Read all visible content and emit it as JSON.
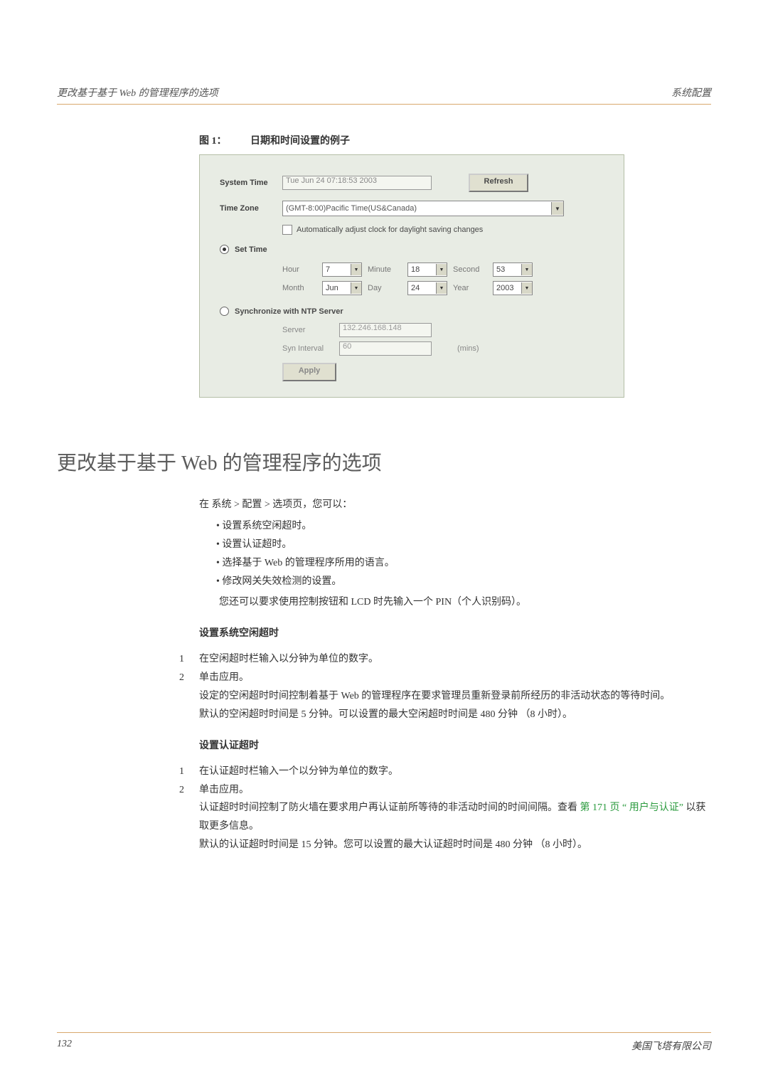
{
  "header": {
    "left": "更改基于基于 Web 的管理程序的选项",
    "right": "系统配置"
  },
  "figure": {
    "label": "图 1：",
    "caption": "日期和时间设置的例子"
  },
  "panel": {
    "systemTimeLabel": "System Time",
    "systemTimeValue": "Tue Jun 24 07:18:53 2003",
    "refresh": "Refresh",
    "timeZoneLabel": "Time Zone",
    "timeZoneValue": "(GMT-8:00)Pacific Time(US&Canada)",
    "dstLabel": "Automatically adjust clock for daylight saving changes",
    "setTimeLabel": "Set Time",
    "fields": {
      "hour": {
        "label": "Hour",
        "value": "7"
      },
      "minute": {
        "label": "Minute",
        "value": "18"
      },
      "second": {
        "label": "Second",
        "value": "53"
      },
      "month": {
        "label": "Month",
        "value": "Jun"
      },
      "day": {
        "label": "Day",
        "value": "24"
      },
      "year": {
        "label": "Year",
        "value": "2003"
      }
    },
    "ntpLabel": "Synchronize with NTP Server",
    "ntp": {
      "serverLabel": "Server",
      "serverValue": "132.246.168.148",
      "intervalLabel": "Syn Interval",
      "intervalValue": "60",
      "intervalUnit": "(mins)"
    },
    "apply": "Apply"
  },
  "section": {
    "title": "更改基于基于 Web 的管理程序的选项",
    "intro": "在 系统 > 配置 > 选项页，您可以：",
    "bullets": [
      "设置系统空闲超时。",
      "设置认证超时。",
      "选择基于 Web 的管理程序所用的语言。",
      "修改网关失效检测的设置。"
    ],
    "pinNote": "您还可以要求使用控制按钮和 LCD 时先输入一个 PIN（个人识别码）。",
    "sub1": {
      "heading": "设置系统空闲超时",
      "step1": "在空闲超时栏输入以分钟为单位的数字。",
      "step2": "单击应用。",
      "para1": "设定的空闲超时时间控制着基于 Web 的管理程序在要求管理员重新登录前所经历的非活动状态的等待时间。",
      "para2": "默认的空闲超时时间是 5 分钟。可以设置的最大空闲超时时间是 480 分钟 （8 小时）。"
    },
    "sub2": {
      "heading": "设置认证超时",
      "step1": "在认证超时栏输入一个以分钟为单位的数字。",
      "step2": "单击应用。",
      "para1a": "认证超时时间控制了防火墙在要求用户再认证前所等待的非活动时间的时间间隔。查看",
      "link": "第 171 页 “ 用户与认证”",
      "para1b": "以获取更多信息。",
      "para2": "默认的认证超时时间是 15 分钟。您可以设置的最大认证超时时间是 480 分钟 （8 小时）。"
    }
  },
  "footer": {
    "pageNum": "132",
    "company": "美国飞塔有限公司"
  }
}
